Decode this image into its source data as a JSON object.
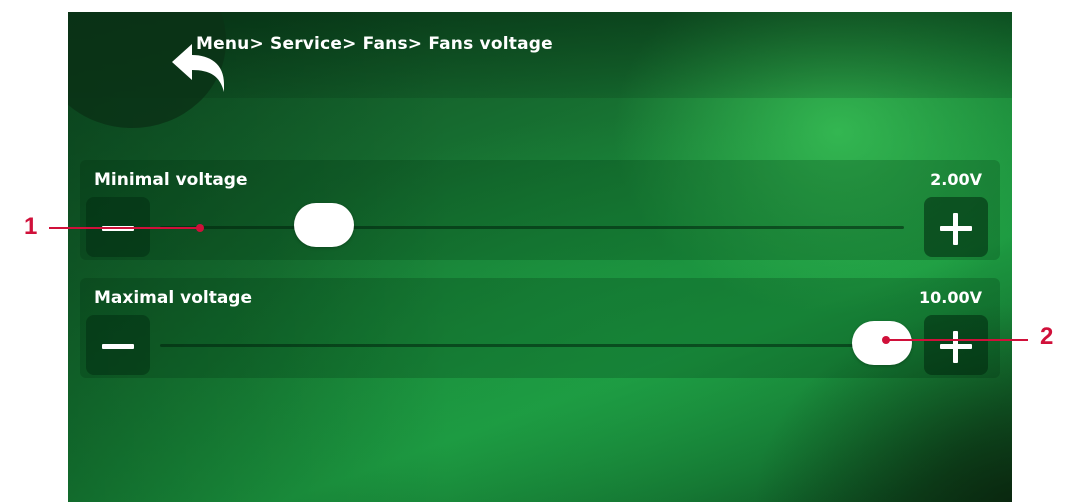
{
  "header": {
    "breadcrumb": "Menu> Service> Fans> Fans voltage",
    "back_icon": "back-arrow-icon"
  },
  "settings": [
    {
      "id": "min",
      "label": "Minimal voltage",
      "value": "2.00V",
      "slider_fraction": 0.22,
      "minus_icon": "minus-icon",
      "plus_icon": "plus-icon"
    },
    {
      "id": "max",
      "label": "Maximal voltage",
      "value": "10.00V",
      "slider_fraction": 0.97,
      "minus_icon": "minus-icon",
      "plus_icon": "plus-icon"
    }
  ],
  "callouts": {
    "first": "1",
    "second": "2",
    "color": "#d0103a"
  },
  "colors": {
    "background": "#1a8a3a",
    "text": "#ffffff"
  }
}
